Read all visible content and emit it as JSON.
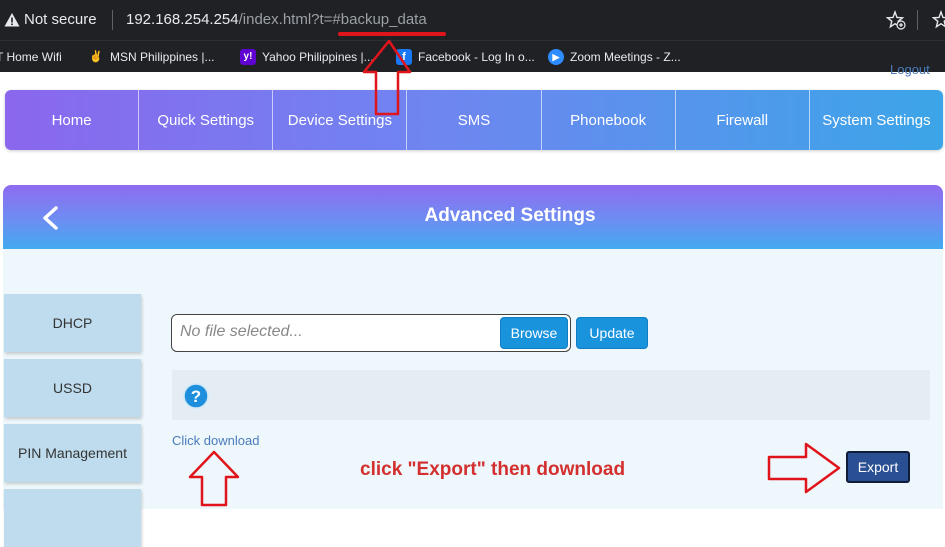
{
  "browser": {
    "security_label": "Not secure",
    "url_host": "192.168.254.254",
    "url_path": "/index.html?t=#backup_data"
  },
  "bookmarks": [
    {
      "label": "T Home Wifi",
      "icon": "bookmark-generic-icon"
    },
    {
      "label": "MSN Philippines |...",
      "icon": "msn-icon"
    },
    {
      "label": "Yahoo Philippines |...",
      "icon": "yahoo-icon"
    },
    {
      "label": "Facebook - Log In o...",
      "icon": "facebook-icon"
    },
    {
      "label": "Zoom Meetings - Z...",
      "icon": "zoom-icon"
    }
  ],
  "header": {
    "logout_label": "Logout"
  },
  "nav": {
    "items": [
      "Home",
      "Quick Settings",
      "Device Settings",
      "SMS",
      "Phonebook",
      "Firewall",
      "System Settings"
    ]
  },
  "panel": {
    "title": "Advanced Settings"
  },
  "sidebar": {
    "items": [
      "DHCP",
      "USSD",
      "PIN Management"
    ]
  },
  "backup": {
    "file_placeholder": "No file selected...",
    "browse_label": "Browse",
    "update_label": "Update",
    "download_link": "Click download",
    "export_label": "Export"
  },
  "annotation": {
    "text": "click \"Export\" then download"
  },
  "colors": {
    "annotation": "#d32f2f",
    "accent": "#1a93dd",
    "export": "#2a4f93"
  }
}
